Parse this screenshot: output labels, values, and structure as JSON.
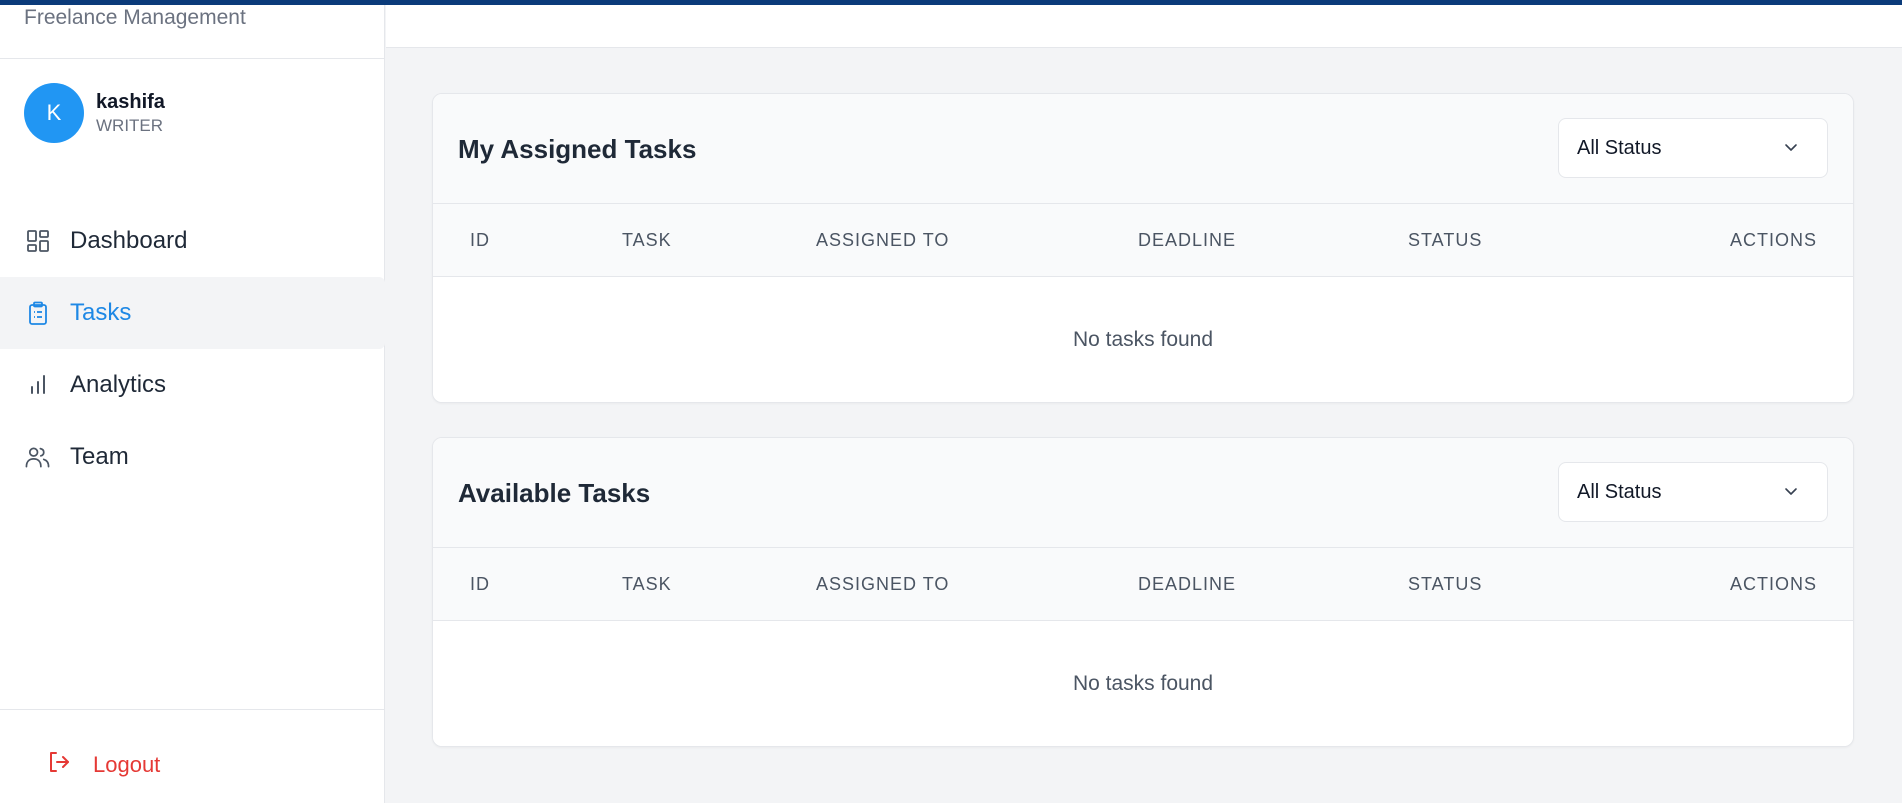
{
  "app": {
    "brand": "Freelance Management"
  },
  "user": {
    "initial": "K",
    "name": "kashifa",
    "role": "WRITER"
  },
  "nav": {
    "items": [
      {
        "label": "Dashboard",
        "icon": "dashboard-icon",
        "active": false
      },
      {
        "label": "Tasks",
        "icon": "clipboard-icon",
        "active": true
      },
      {
        "label": "Analytics",
        "icon": "bar-chart-icon",
        "active": false
      },
      {
        "label": "Team",
        "icon": "users-icon",
        "active": false
      }
    ],
    "logout_label": "Logout"
  },
  "colors": {
    "accent": "#1e88e5",
    "avatar": "#2196f3",
    "logout": "#e53935",
    "topbar": "#0b3b7a"
  },
  "assigned": {
    "title": "My Assigned Tasks",
    "filter_value": "All Status",
    "columns": [
      "ID",
      "TASK",
      "ASSIGNED TO",
      "DEADLINE",
      "STATUS",
      "ACTIONS"
    ],
    "rows": [],
    "empty_text": "No tasks found"
  },
  "available": {
    "title": "Available Tasks",
    "filter_value": "All Status",
    "columns": [
      "ID",
      "TASK",
      "ASSIGNED TO",
      "DEADLINE",
      "STATUS",
      "ACTIONS"
    ],
    "rows": [],
    "empty_text": "No tasks found"
  }
}
